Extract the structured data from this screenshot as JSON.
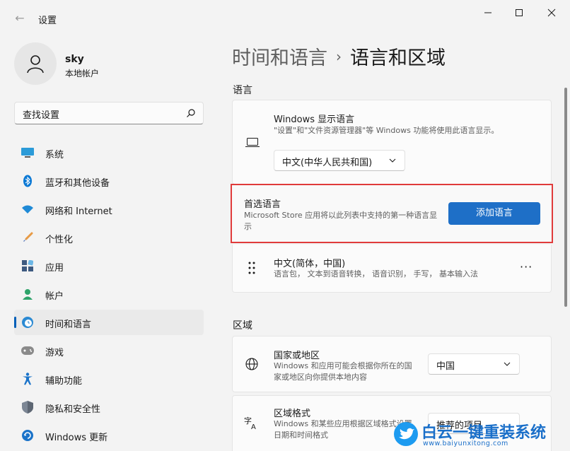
{
  "window": {
    "title": "设置",
    "back_icon": "back-arrow-icon",
    "minimize_icon": "minimize-icon",
    "maximize_icon": "maximize-icon",
    "close_icon": "close-icon"
  },
  "profile": {
    "name": "sky",
    "account_type": "本地帐户"
  },
  "search": {
    "placeholder": "查找设置"
  },
  "sidebar": {
    "items": [
      {
        "label": "系统",
        "icon": "system-display-icon",
        "active": false
      },
      {
        "label": "蓝牙和其他设备",
        "icon": "bluetooth-icon",
        "active": false
      },
      {
        "label": "网络和 Internet",
        "icon": "wifi-icon",
        "active": false
      },
      {
        "label": "个性化",
        "icon": "brush-icon",
        "active": false
      },
      {
        "label": "应用",
        "icon": "apps-icon",
        "active": false
      },
      {
        "label": "帐户",
        "icon": "account-icon",
        "active": false
      },
      {
        "label": "时间和语言",
        "icon": "clock-globe-icon",
        "active": true
      },
      {
        "label": "游戏",
        "icon": "gamepad-icon",
        "active": false
      },
      {
        "label": "辅助功能",
        "icon": "accessibility-icon",
        "active": false
      },
      {
        "label": "隐私和安全性",
        "icon": "shield-icon",
        "active": false
      },
      {
        "label": "Windows 更新",
        "icon": "update-icon",
        "active": false
      }
    ]
  },
  "breadcrumb": {
    "parent": "时间和语言",
    "separator": "›",
    "current": "语言和区域"
  },
  "language_section": {
    "title": "语言",
    "display_language": {
      "title": "Windows 显示语言",
      "description": "\"设置\"和\"文件资源管理器\"等 Windows 功能将使用此语言显示。",
      "value": "中文(中华人民共和国)"
    },
    "preferred": {
      "title": "首选语言",
      "description": "Microsoft Store 应用将以此列表中支持的第一种语言显示",
      "button": "添加语言"
    },
    "installed": {
      "title": "中文(简体，中国)",
      "description": "语言包， 文本到语音转换， 语音识别， 手写， 基本输入法",
      "more": "···"
    }
  },
  "region_section": {
    "title": "区域",
    "country": {
      "title": "国家或地区",
      "description": "Windows 和应用可能会根据你所在的国家或地区向你提供本地内容",
      "value": "中国"
    },
    "format": {
      "title": "区域格式",
      "description": "Windows 和某些应用根据区域格式设置日期和时间格式",
      "value": "推荐的项目"
    }
  },
  "watermark": {
    "title": "白云一键重装系统",
    "url": "www.baiyunxitong.com"
  },
  "colors": {
    "accent": "#1e6fc7",
    "highlight_border": "#e03b3b",
    "background": "#f3f3f3"
  }
}
